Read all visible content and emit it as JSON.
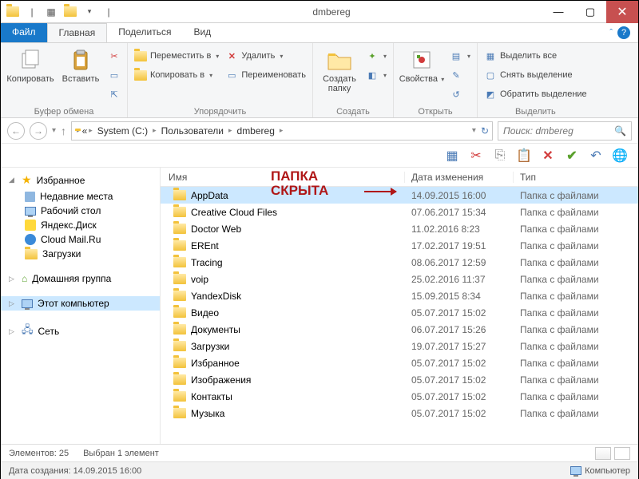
{
  "window": {
    "title": "dmbereg"
  },
  "tabs": {
    "file": "Файл",
    "items": [
      "Главная",
      "Поделиться",
      "Вид"
    ],
    "active": 0
  },
  "ribbon": {
    "clipboard": {
      "label": "Буфер обмена",
      "copy": "Копировать",
      "paste": "Вставить"
    },
    "organize": {
      "label": "Упорядочить",
      "move_to": "Переместить в",
      "copy_to": "Копировать в",
      "delete": "Удалить",
      "rename": "Переименовать"
    },
    "new": {
      "label": "Создать",
      "new_folder": "Создать\nпапку"
    },
    "open": {
      "label": "Открыть",
      "properties": "Свойства"
    },
    "select": {
      "label": "Выделить",
      "select_all": "Выделить все",
      "select_none": "Снять выделение",
      "invert": "Обратить выделение"
    }
  },
  "breadcrumb": {
    "items": [
      "System (C:)",
      "Пользователи",
      "dmbereg"
    ]
  },
  "search": {
    "placeholder": "Поиск: dmbereg"
  },
  "sidebar": {
    "favorites": {
      "label": "Избранное",
      "items": [
        "Недавние места",
        "Рабочий стол",
        "Яндекс.Диск",
        "Cloud Mail.Ru",
        "Загрузки"
      ]
    },
    "homegroup": "Домашняя группа",
    "this_pc": "Этот компьютер",
    "network": "Сеть"
  },
  "columns": {
    "name": "Имя",
    "date": "Дата изменения",
    "type": "Тип"
  },
  "files": [
    {
      "name": "AppData",
      "date": "14.09.2015 16:00",
      "type": "Папка с файлами",
      "selected": true
    },
    {
      "name": "Creative Cloud Files",
      "date": "07.06.2017 15:34",
      "type": "Папка с файлами"
    },
    {
      "name": "Doctor Web",
      "date": "11.02.2016 8:23",
      "type": "Папка с файлами"
    },
    {
      "name": "EREnt",
      "date": "17.02.2017 19:51",
      "type": "Папка с файлами"
    },
    {
      "name": "Tracing",
      "date": "08.06.2017 12:59",
      "type": "Папка с файлами"
    },
    {
      "name": "voip",
      "date": "25.02.2016 11:37",
      "type": "Папка с файлами"
    },
    {
      "name": "YandexDisk",
      "date": "15.09.2015 8:34",
      "type": "Папка с файлами"
    },
    {
      "name": "Видео",
      "date": "05.07.2017 15:02",
      "type": "Папка с файлами"
    },
    {
      "name": "Документы",
      "date": "06.07.2017 15:26",
      "type": "Папка с файлами"
    },
    {
      "name": "Загрузки",
      "date": "19.07.2017 15:27",
      "type": "Папка с файлами"
    },
    {
      "name": "Избранное",
      "date": "05.07.2017 15:02",
      "type": "Папка с файлами"
    },
    {
      "name": "Изображения",
      "date": "05.07.2017 15:02",
      "type": "Папка с файлами"
    },
    {
      "name": "Контакты",
      "date": "05.07.2017 15:02",
      "type": "Папка с файлами"
    },
    {
      "name": "Музыка",
      "date": "05.07.2017 15:02",
      "type": "Папка с файлами"
    }
  ],
  "annotation": {
    "line1": "ПАПКА",
    "line2": "СКРЫТА"
  },
  "status": {
    "count": "Элементов: 25",
    "selected": "Выбран 1 элемент",
    "created": "Дата создания: 14.09.2015 16:00",
    "computer": "Компьютер"
  }
}
